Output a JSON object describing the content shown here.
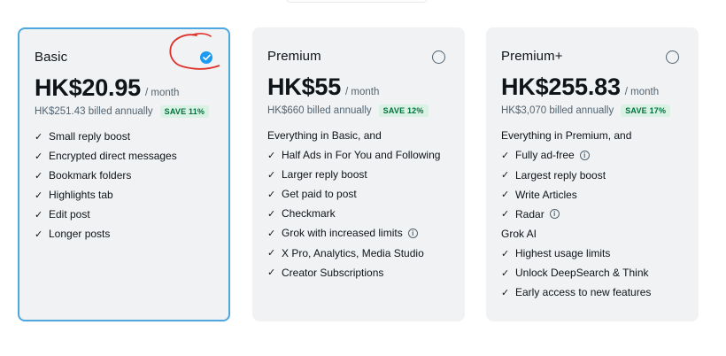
{
  "plans": [
    {
      "name": "Basic",
      "price": "HK$20.95",
      "per": "/ month",
      "billed": "HK$251.43 billed annually",
      "save": "SAVE 11%",
      "selected": true,
      "features": [
        "Small reply boost",
        "Encrypted direct messages",
        "Bookmark folders",
        "Highlights tab",
        "Edit post",
        "Longer posts"
      ]
    },
    {
      "name": "Premium",
      "price": "HK$55",
      "per": "/ month",
      "billed": "HK$660 billed annually",
      "save": "SAVE 12%",
      "selected": false,
      "heading": "Everything in Basic, and",
      "features": [
        "Half Ads in For You and Following",
        "Larger reply boost",
        "Get paid to post",
        "Checkmark",
        "Grok with increased limits",
        "X Pro, Analytics, Media Studio",
        "Creator Subscriptions"
      ]
    },
    {
      "name": "Premium+",
      "price": "HK$255.83",
      "per": "/ month",
      "billed": "HK$3,070 billed annually",
      "save": "SAVE 17%",
      "selected": false,
      "heading": "Everything in Premium, and",
      "features": [
        "Fully ad-free",
        "Largest reply boost",
        "Write Articles",
        "Radar"
      ],
      "heading2": "Grok AI",
      "features2": [
        "Highest usage limits",
        "Unlock DeepSearch & Think",
        "Early access to new features"
      ]
    }
  ],
  "icons": {
    "check": "✓",
    "info": "i"
  },
  "colors": {
    "accent": "#1d9bf0",
    "selected_border": "#4ea8df",
    "save_bg": "#d9f2e4",
    "save_text": "#00703c",
    "annotation": "#e0302a"
  }
}
